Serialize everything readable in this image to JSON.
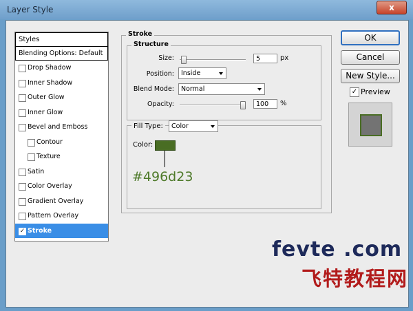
{
  "window": {
    "title": "Layer Style",
    "close_glyph": "x"
  },
  "styles_panel": {
    "header": "Styles",
    "blending_options": "Blending Options: Default",
    "items": [
      {
        "label": "Drop Shadow",
        "checked": false,
        "sub": false
      },
      {
        "label": "Inner Shadow",
        "checked": false,
        "sub": false
      },
      {
        "label": "Outer Glow",
        "checked": false,
        "sub": false
      },
      {
        "label": "Inner Glow",
        "checked": false,
        "sub": false
      },
      {
        "label": "Bevel and Emboss",
        "checked": false,
        "sub": false
      },
      {
        "label": "Contour",
        "checked": false,
        "sub": true
      },
      {
        "label": "Texture",
        "checked": false,
        "sub": true
      },
      {
        "label": "Satin",
        "checked": false,
        "sub": false
      },
      {
        "label": "Color Overlay",
        "checked": false,
        "sub": false
      },
      {
        "label": "Gradient Overlay",
        "checked": false,
        "sub": false
      },
      {
        "label": "Pattern Overlay",
        "checked": false,
        "sub": false
      },
      {
        "label": "Stroke",
        "checked": true,
        "sub": false,
        "selected": true
      }
    ]
  },
  "stroke": {
    "title": "Stroke",
    "structure": {
      "title": "Structure",
      "size_label": "Size:",
      "size_value": "5",
      "size_unit": "px",
      "size_slider_level": 0.02,
      "position_label": "Position:",
      "position_value": "Inside",
      "blend_mode_label": "Blend Mode:",
      "blend_mode_value": "Normal",
      "opacity_label": "Opacity:",
      "opacity_value": "100",
      "opacity_unit": "%",
      "opacity_slider_level": 1.0
    },
    "fill": {
      "fill_type_label": "Fill Type:",
      "fill_type_value": "Color",
      "color_label": "Color:",
      "color_hex": "#496d23"
    }
  },
  "buttons": {
    "ok": "OK",
    "cancel": "Cancel",
    "new_style": "New Style..."
  },
  "preview": {
    "label": "Preview",
    "checked": true
  },
  "annotation": {
    "hex_text": "#496d23"
  },
  "watermark": {
    "en": "fevte .com",
    "cn": "飞特教程网"
  }
}
